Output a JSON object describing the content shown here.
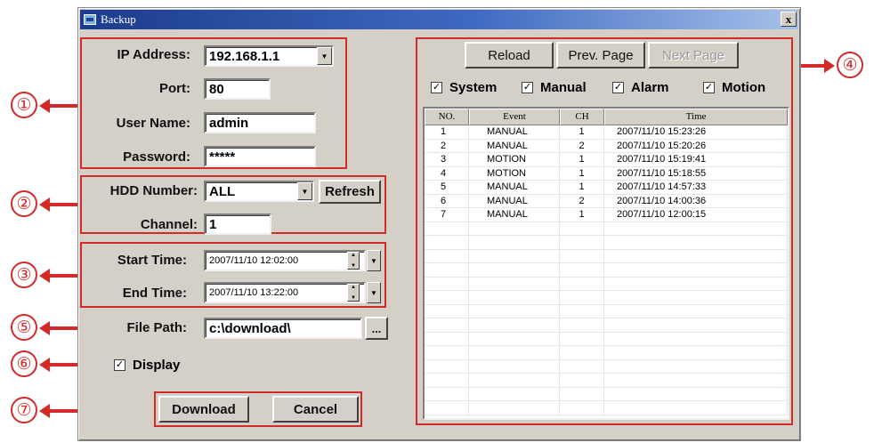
{
  "window": {
    "title": "Backup",
    "close_label": "x"
  },
  "callouts": [
    "①",
    "②",
    "③",
    "④",
    "⑤",
    "⑥",
    "⑦"
  ],
  "connection": {
    "ip_label": "IP Address:",
    "ip_value": "192.168.1.1",
    "port_label": "Port:",
    "port_value": "80",
    "user_label": "User Name:",
    "user_value": "admin",
    "password_label": "Password:",
    "password_value": "*****"
  },
  "hdd": {
    "hdd_label": "HDD Number:",
    "hdd_value": "ALL",
    "refresh_label": "Refresh",
    "channel_label": "Channel:",
    "channel_value": "1"
  },
  "time": {
    "start_label": "Start Time:",
    "start_value": "2007/11/10 12:02:00",
    "end_label": "End Time:",
    "end_value": "2007/11/10 13:22:00"
  },
  "file": {
    "path_label": "File Path:",
    "path_value": "c:\\download\\",
    "browse_label": "..."
  },
  "display": {
    "label": "Display",
    "checked": true
  },
  "actions": {
    "download_label": "Download",
    "cancel_label": "Cancel"
  },
  "event_panel": {
    "reload_label": "Reload",
    "prev_label": "Prev. Page",
    "next_label": "Next Page",
    "filters": [
      {
        "label": "System",
        "checked": true
      },
      {
        "label": "Manual",
        "checked": true
      },
      {
        "label": "Alarm",
        "checked": true
      },
      {
        "label": "Motion",
        "checked": true
      }
    ],
    "columns": [
      "NO.",
      "Event",
      "CH",
      "Time"
    ],
    "rows": [
      {
        "no": "1",
        "event": "MANUAL",
        "ch": "1",
        "time": "2007/11/10 15:23:26"
      },
      {
        "no": "2",
        "event": "MANUAL",
        "ch": "2",
        "time": "2007/11/10 15:20:26"
      },
      {
        "no": "3",
        "event": "MOTION",
        "ch": "1",
        "time": "2007/11/10 15:19:41"
      },
      {
        "no": "4",
        "event": "MOTION",
        "ch": "1",
        "time": "2007/11/10 15:18:55"
      },
      {
        "no": "5",
        "event": "MANUAL",
        "ch": "1",
        "time": "2007/11/10 14:57:33"
      },
      {
        "no": "6",
        "event": "MANUAL",
        "ch": "2",
        "time": "2007/11/10 14:00:36"
      },
      {
        "no": "7",
        "event": "MANUAL",
        "ch": "1",
        "time": "2007/11/10 12:00:15"
      }
    ]
  },
  "colors": {
    "annotation": "#d42a2a",
    "window_bg": "#d4d0c8",
    "titlebar": "#1c3b8c"
  }
}
